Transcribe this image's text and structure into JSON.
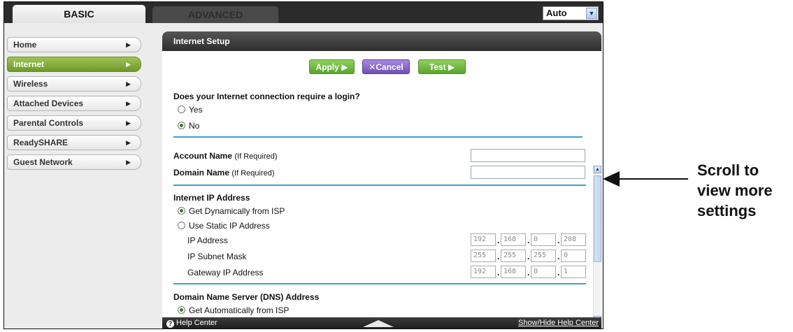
{
  "tabs": {
    "basic": "BASIC",
    "advanced": "ADVANCED"
  },
  "language": {
    "selected": "Auto"
  },
  "menu": [
    {
      "label": "Home"
    },
    {
      "label": "Internet"
    },
    {
      "label": "Wireless"
    },
    {
      "label": "Attached Devices"
    },
    {
      "label": "Parental Controls"
    },
    {
      "label": "ReadySHARE"
    },
    {
      "label": "Guest Network"
    }
  ],
  "panel": {
    "title": "Internet Setup",
    "buttons": {
      "apply": "Apply ▶",
      "cancel": "✕Cancel",
      "test": "Test ▶"
    },
    "login_question": "Does your Internet connection require a login?",
    "login_yes": "Yes",
    "login_no": "No",
    "account_name": "Account Name",
    "domain_name": "Domain Name",
    "if_required": "(If Required)",
    "ip_section": "Internet IP Address",
    "ip_dynamic": "Get Dynamically from ISP",
    "ip_static": "Use Static IP Address",
    "ip_address_label": "IP Address",
    "subnet_label": "IP Subnet Mask",
    "gateway_label": "Gateway IP Address",
    "ip_address": [
      "192",
      "168",
      "0",
      "208"
    ],
    "subnet": [
      "255",
      "255",
      "255",
      "0"
    ],
    "gateway": [
      "192",
      "168",
      "0",
      "1"
    ],
    "dns_section": "Domain Name Server (DNS) Address",
    "dns_auto": "Get Automatically from ISP"
  },
  "footer": {
    "help": "Help Center",
    "toggle": "Show/Hide Help Center"
  },
  "annotation": {
    "line1": "Scroll to",
    "line2": "view more",
    "line3": "settings"
  }
}
